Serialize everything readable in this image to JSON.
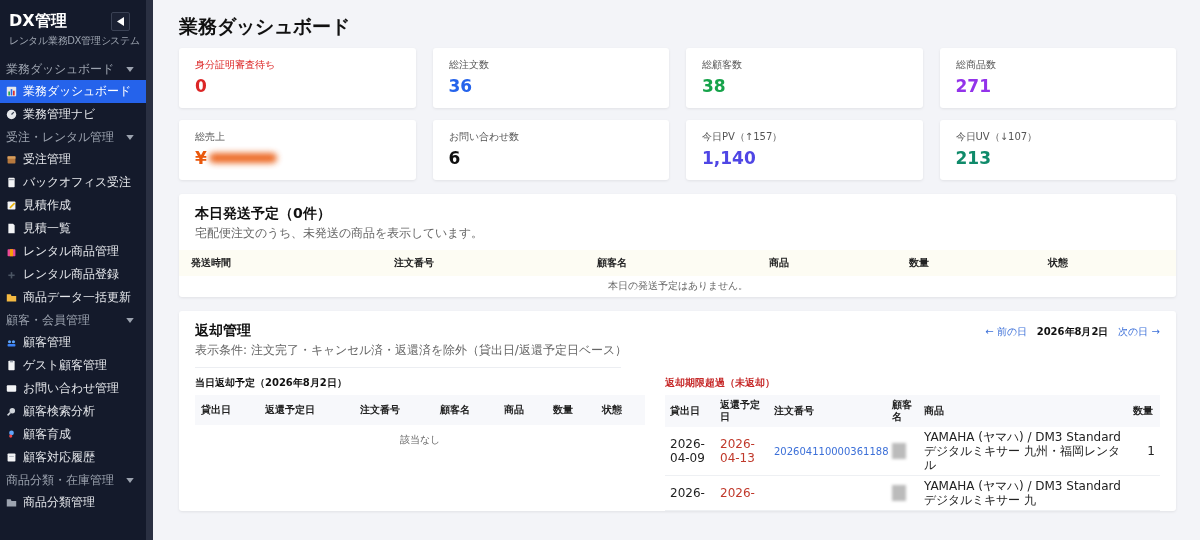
{
  "sidebar": {
    "logo": "DX管理",
    "subtitle": "レンタル業務DX管理システム",
    "groups": [
      {
        "label": "業務ダッシュボード",
        "expanded": true,
        "items": [
          {
            "label": "業務ダッシュボード",
            "selected": true
          },
          {
            "label": "業務管理ナビ",
            "selected": false
          }
        ]
      },
      {
        "label": "受注・レンタル管理",
        "expanded": true,
        "items": [
          {
            "label": "受注管理",
            "selected": false
          },
          {
            "label": "バックオフィス受注",
            "selected": false
          },
          {
            "label": "見積作成",
            "selected": false
          },
          {
            "label": "見積一覧",
            "selected": false
          },
          {
            "label": "レンタル商品管理",
            "selected": false
          },
          {
            "label": "レンタル商品登録",
            "selected": false
          },
          {
            "label": "商品データ一括更新",
            "selected": false
          }
        ]
      },
      {
        "label": "顧客・会員管理",
        "expanded": true,
        "items": [
          {
            "label": "顧客管理",
            "selected": false
          },
          {
            "label": "ゲスト顧客管理",
            "selected": false
          },
          {
            "label": "お問い合わせ管理",
            "selected": false
          },
          {
            "label": "顧客検索分析",
            "selected": false
          },
          {
            "label": "顧客育成",
            "selected": false
          },
          {
            "label": "顧客対応履歴",
            "selected": false
          }
        ]
      },
      {
        "label": "商品分類・在庫管理",
        "expanded": true,
        "items": [
          {
            "label": "商品分類管理",
            "selected": false
          }
        ]
      }
    ]
  },
  "page_title": "業務ダッシュボード",
  "stats": [
    {
      "label": "身分証明審査待ち",
      "value": "0",
      "color": "#dc2626",
      "alert": true,
      "redacted": false
    },
    {
      "label": "総注文数",
      "value": "36",
      "color": "#2563eb",
      "alert": false,
      "redacted": false
    },
    {
      "label": "総顧客数",
      "value": "38",
      "color": "#16a34a",
      "alert": false,
      "redacted": false
    },
    {
      "label": "総商品数",
      "value": "271",
      "color": "#9333ea",
      "alert": false,
      "redacted": false
    },
    {
      "label": "総売上",
      "value": "¥",
      "color": "#ea580c",
      "alert": false,
      "redacted": true
    },
    {
      "label": "お問い合わせ数",
      "value": "6",
      "color": "#111111",
      "alert": false,
      "redacted": false
    },
    {
      "label": "今日PV（↑157）",
      "value": "1,140",
      "color": "#4f46e5",
      "alert": false,
      "redacted": false
    },
    {
      "label": "今日UV（↓107）",
      "value": "213",
      "color": "#0f8a6a",
      "alert": false,
      "redacted": false
    }
  ],
  "shipping": {
    "title": "本日発送予定（0件）",
    "subtitle": "宅配便注文のうち、未発送の商品を表示しています。",
    "columns": [
      "発送時間",
      "注文番号",
      "顧客名",
      "商品",
      "数量",
      "状態"
    ],
    "empty": "本日の発送予定はありません。"
  },
  "returns": {
    "title": "返却管理",
    "subtitle": "表示条件: 注文完了・キャンセル済・返還済を除外（貸出日/返還予定日ベース）",
    "prev": "← 前の日",
    "date": "2026年8月2日",
    "next": "次の日 →",
    "today": {
      "title": "当日返却予定（2026年8月2日）",
      "columns": [
        "貸出日",
        "返還予定日",
        "注文番号",
        "顧客名",
        "商品",
        "数量",
        "状態"
      ],
      "empty": "該当なし"
    },
    "overdue": {
      "title": "返却期限超過（未返却）",
      "columns": [
        "貸出日",
        "返還予定日",
        "注文番号",
        "顧客名",
        "商品",
        "数量"
      ],
      "rows": [
        {
          "lend_date": "2026-04-09",
          "due_date": "2026-04-13",
          "order_no": "202604110000361188",
          "customer_redacted": true,
          "product": "YAMAHA (ヤマハ) / DM3 Standard デジタルミキサー 九州・福岡レンタル",
          "qty": "1"
        },
        {
          "lend_date": "2026-",
          "due_date": "2026-",
          "order_no": "",
          "customer_redacted": true,
          "product": "YAMAHA (ヤマハ) / DM3 Standard デジタルミキサー 九",
          "qty": ""
        }
      ]
    }
  }
}
